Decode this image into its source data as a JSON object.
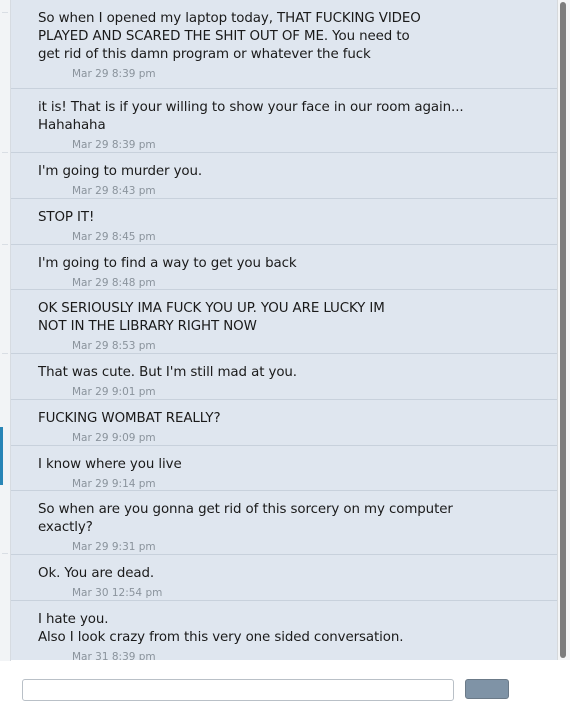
{
  "conversation": {
    "messages": [
      {
        "text": "So when I opened my laptop today, THAT FUCKING VIDEO\nPLAYED AND SCARED THE SHIT OUT OF ME. You need to\nget rid of this damn program or whatever the fuck",
        "time": "Mar 29 8:39 pm"
      },
      {
        "text": "it is! That is if your willing to show your face in our room again...\nHahahaha",
        "time": "Mar 29 8:39 pm"
      },
      {
        "text": "I'm going to murder you.",
        "time": "Mar 29 8:43 pm"
      },
      {
        "text": "STOP IT!",
        "time": "Mar 29 8:45 pm"
      },
      {
        "text": "I'm going to find a way to get you back",
        "time": "Mar 29 8:48 pm"
      },
      {
        "text": "OK SERIOUSLY IMA FUCK YOU UP. YOU ARE LUCKY IM\nNOT IN THE LIBRARY RIGHT NOW",
        "time": "Mar 29 8:53 pm"
      },
      {
        "text": "That was cute. But I'm still mad at you.",
        "time": "Mar 29 9:01 pm"
      },
      {
        "text": "FUCKING WOMBAT REALLY?",
        "time": "Mar 29 9:09 pm"
      },
      {
        "text": "I know where you live",
        "time": "Mar 29 9:14 pm"
      },
      {
        "text": "So when are you gonna get rid of this sorcery on my computer\nexactly?",
        "time": "Mar 29 9:31 pm"
      },
      {
        "text": "Ok. You are dead.",
        "time": "Mar 30 12:54 pm"
      },
      {
        "text": "I hate you.\nAlso I look crazy from this very one sided conversation.",
        "time": "Mar 31 8:39 pm"
      }
    ]
  },
  "colors": {
    "message_background": "#dfe6ef",
    "divider": "#c8d1dc",
    "text": "#1a1a1a",
    "timestamp": "#8a939c",
    "left_accent": "#2a86b6"
  }
}
